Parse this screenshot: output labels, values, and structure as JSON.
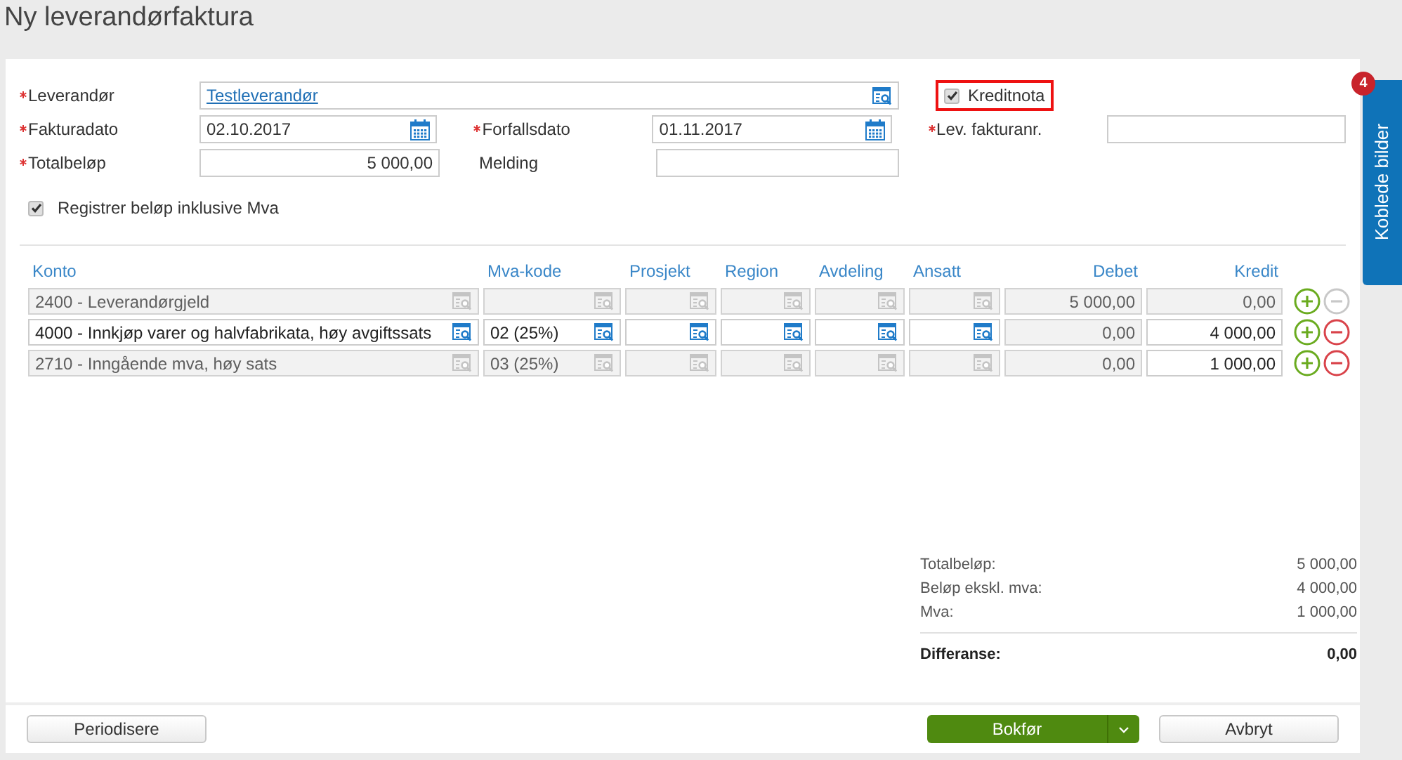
{
  "title": "Ny leverandørfaktura",
  "side_tab": {
    "label": "Koblede bilder",
    "badge": "4"
  },
  "form": {
    "leverandor": {
      "label": "Leverandør",
      "required": true,
      "value": "Testleverandør"
    },
    "kreditnota": {
      "label": "Kreditnota",
      "checked": true
    },
    "fakturadato": {
      "label": "Fakturadato",
      "required": true,
      "value": "02.10.2017"
    },
    "forfallsdato": {
      "label": "Forfallsdato",
      "required": true,
      "value": "01.11.2017"
    },
    "lev_fakturanr": {
      "label": "Lev. fakturanr.",
      "required": true
    },
    "totalbelop": {
      "label": "Totalbeløp",
      "required": true,
      "value": "5 000,00"
    },
    "melding": {
      "label": "Melding",
      "required": false
    },
    "inkl_mva": {
      "label": "Registrer beløp inklusive Mva",
      "checked": true
    }
  },
  "table": {
    "columns": [
      {
        "label": "Konto",
        "kind": "lookup"
      },
      {
        "label": "Mva-kode",
        "kind": "lookup"
      },
      {
        "label": "Prosjekt",
        "kind": "lookup"
      },
      {
        "label": "Region",
        "kind": "lookup"
      },
      {
        "label": "Avdeling",
        "kind": "lookup"
      },
      {
        "label": "Ansatt",
        "kind": "lookup"
      },
      {
        "label": "Debet",
        "kind": "amount"
      },
      {
        "label": "Kredit",
        "kind": "amount"
      }
    ],
    "rows": [
      {
        "remove_disabled": true,
        "cells": [
          {
            "value": "2400 - Leverandørgjeld",
            "disabled": true
          },
          {
            "disabled": true
          },
          {
            "disabled": true
          },
          {
            "disabled": true
          },
          {
            "disabled": true
          },
          {
            "disabled": true
          },
          {
            "value": "5 000,00",
            "disabled": true
          },
          {
            "value": "0,00",
            "disabled": true
          }
        ]
      },
      {
        "remove_disabled": false,
        "cells": [
          {
            "value": "4000 - Innkjøp varer og halvfabrikata, høy avgiftssats",
            "disabled": false
          },
          {
            "value": "02 (25%)",
            "disabled": false
          },
          {
            "disabled": false
          },
          {
            "disabled": false
          },
          {
            "disabled": false
          },
          {
            "disabled": false
          },
          {
            "value": "0,00",
            "disabled": true
          },
          {
            "value": "4 000,00",
            "disabled": false
          }
        ]
      },
      {
        "remove_disabled": false,
        "cells": [
          {
            "value": "2710 - Inngående mva, høy sats",
            "disabled": true
          },
          {
            "value": "03 (25%)",
            "disabled": true
          },
          {
            "disabled": true
          },
          {
            "disabled": true
          },
          {
            "disabled": true
          },
          {
            "disabled": true
          },
          {
            "value": "0,00",
            "disabled": true
          },
          {
            "value": "1 000,00",
            "disabled": false
          }
        ]
      }
    ]
  },
  "summary": {
    "lines": [
      {
        "label": "Totalbeløp:",
        "value": "5 000,00"
      },
      {
        "label": "Beløp ekskl. mva:",
        "value": "4 000,00"
      },
      {
        "label": "Mva:",
        "value": "1 000,00"
      }
    ],
    "difference": {
      "label": "Differanse:",
      "value": "0,00"
    }
  },
  "buttons": {
    "periodisere": "Periodisere",
    "bokfor": "Bokfør",
    "avbryt": "Avbryt"
  }
}
